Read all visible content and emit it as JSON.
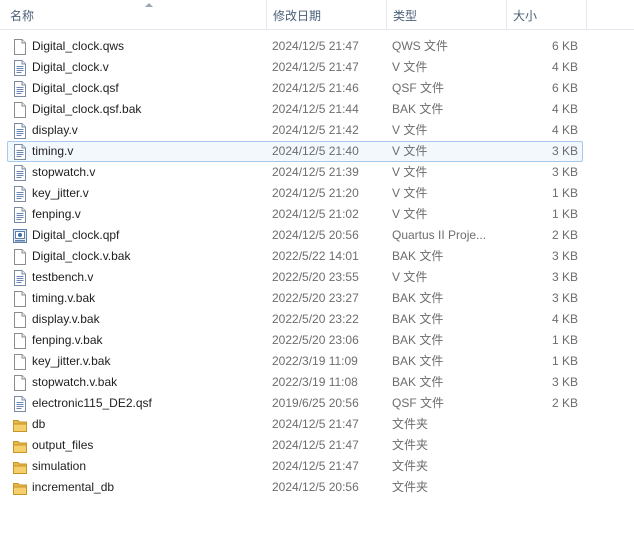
{
  "columns": {
    "name": "名称",
    "date": "修改日期",
    "type": "类型",
    "size": "大小"
  },
  "files": [
    {
      "name": "Digital_clock.qws",
      "date": "2024/12/5 21:47",
      "type": "QWS 文件",
      "size": "6 KB",
      "icon": "blank-file-icon"
    },
    {
      "name": "Digital_clock.v",
      "date": "2024/12/5 21:47",
      "type": "V 文件",
      "size": "4 KB",
      "icon": "text-file-icon"
    },
    {
      "name": "Digital_clock.qsf",
      "date": "2024/12/5 21:46",
      "type": "QSF 文件",
      "size": "6 KB",
      "icon": "text-file-icon"
    },
    {
      "name": "Digital_clock.qsf.bak",
      "date": "2024/12/5 21:44",
      "type": "BAK 文件",
      "size": "4 KB",
      "icon": "blank-file-icon"
    },
    {
      "name": "display.v",
      "date": "2024/12/5 21:42",
      "type": "V 文件",
      "size": "4 KB",
      "icon": "text-file-icon"
    },
    {
      "name": "timing.v",
      "date": "2024/12/5 21:40",
      "type": "V 文件",
      "size": "3 KB",
      "icon": "text-file-icon",
      "selected": true
    },
    {
      "name": "stopwatch.v",
      "date": "2024/12/5 21:39",
      "type": "V 文件",
      "size": "3 KB",
      "icon": "text-file-icon"
    },
    {
      "name": "key_jitter.v",
      "date": "2024/12/5 21:20",
      "type": "V 文件",
      "size": "1 KB",
      "icon": "text-file-icon"
    },
    {
      "name": "fenping.v",
      "date": "2024/12/5 21:02",
      "type": "V 文件",
      "size": "1 KB",
      "icon": "text-file-icon"
    },
    {
      "name": "Digital_clock.qpf",
      "date": "2024/12/5 20:56",
      "type": "Quartus II Proje...",
      "size": "2 KB",
      "icon": "quartus-project-icon"
    },
    {
      "name": "Digital_clock.v.bak",
      "date": "2022/5/22 14:01",
      "type": "BAK 文件",
      "size": "3 KB",
      "icon": "blank-file-icon"
    },
    {
      "name": "testbench.v",
      "date": "2022/5/20 23:55",
      "type": "V 文件",
      "size": "3 KB",
      "icon": "text-file-icon"
    },
    {
      "name": "timing.v.bak",
      "date": "2022/5/20 23:27",
      "type": "BAK 文件",
      "size": "3 KB",
      "icon": "blank-file-icon"
    },
    {
      "name": "display.v.bak",
      "date": "2022/5/20 23:22",
      "type": "BAK 文件",
      "size": "4 KB",
      "icon": "blank-file-icon"
    },
    {
      "name": "fenping.v.bak",
      "date": "2022/5/20 23:06",
      "type": "BAK 文件",
      "size": "1 KB",
      "icon": "blank-file-icon"
    },
    {
      "name": "key_jitter.v.bak",
      "date": "2022/3/19 11:09",
      "type": "BAK 文件",
      "size": "1 KB",
      "icon": "blank-file-icon"
    },
    {
      "name": "stopwatch.v.bak",
      "date": "2022/3/19 11:08",
      "type": "BAK 文件",
      "size": "3 KB",
      "icon": "blank-file-icon"
    },
    {
      "name": "electronic115_DE2.qsf",
      "date": "2019/6/25 20:56",
      "type": "QSF 文件",
      "size": "2 KB",
      "icon": "text-file-icon"
    },
    {
      "name": "db",
      "date": "2024/12/5 21:47",
      "type": "文件夹",
      "size": "",
      "icon": "folder-icon"
    },
    {
      "name": "output_files",
      "date": "2024/12/5 21:47",
      "type": "文件夹",
      "size": "",
      "icon": "folder-icon"
    },
    {
      "name": "simulation",
      "date": "2024/12/5 21:47",
      "type": "文件夹",
      "size": "",
      "icon": "folder-icon"
    },
    {
      "name": "incremental_db",
      "date": "2024/12/5 20:56",
      "type": "文件夹",
      "size": "",
      "icon": "folder-icon"
    }
  ],
  "colors": {
    "selection_border": "#a8c8ec",
    "selection_fill": "#f3f8fd",
    "folder": "#e8b84a",
    "header_text": "#4c607a",
    "meta_text": "#6d6d6d"
  }
}
